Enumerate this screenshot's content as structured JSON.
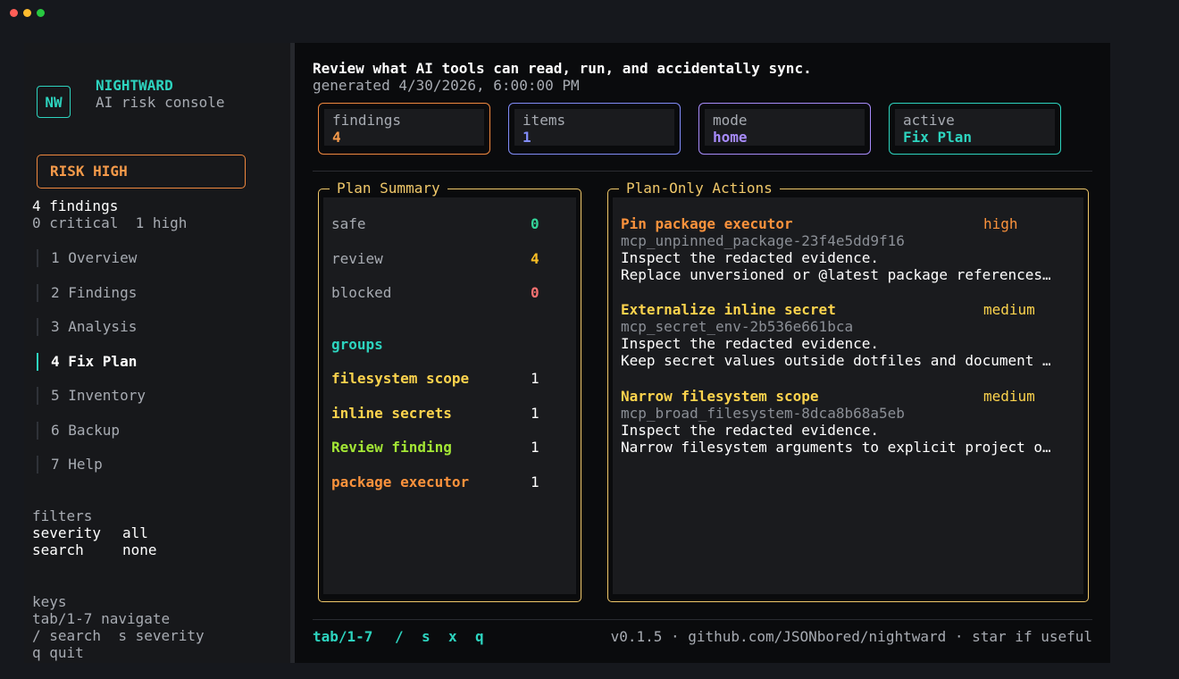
{
  "window": {
    "dots": [
      "#ff5f57",
      "#febc2e",
      "#28c840"
    ]
  },
  "sidebar": {
    "logo": "NW",
    "app_name": "NIGHTWARD",
    "app_subtitle": "AI risk console",
    "risk_label": "RISK HIGH",
    "findings_count": "4 findings",
    "severity_counts": "0 critical  1 high",
    "nav": [
      {
        "label": "1 Overview"
      },
      {
        "label": "2 Findings"
      },
      {
        "label": "3 Analysis"
      },
      {
        "label": "4 Fix Plan",
        "active": true
      },
      {
        "label": "5 Inventory"
      },
      {
        "label": "6 Backup"
      },
      {
        "label": "7 Help"
      }
    ],
    "filters_heading": "filters",
    "filters": [
      {
        "key": "severity",
        "value": "all"
      },
      {
        "key": "search",
        "value": "none"
      }
    ],
    "keys_heading": "keys",
    "keys": [
      "tab/1-7 navigate",
      "/ search  s severity",
      "q quit"
    ]
  },
  "header": {
    "title": "Review what AI tools can read, run, and accidentally sync.",
    "generated": "generated 4/30/2026, 6:00:00 PM"
  },
  "stats": [
    {
      "label": "findings",
      "value": "4",
      "color": "#f0883e"
    },
    {
      "label": "items",
      "value": "1",
      "color": "#818cf8"
    },
    {
      "label": "mode",
      "value": "home",
      "color": "#a78bfa"
    },
    {
      "label": "active",
      "value": "Fix Plan",
      "color": "#2dd4bf"
    }
  ],
  "plan_summary": {
    "title": "Plan Summary",
    "counts": [
      {
        "label": "safe",
        "value": "0",
        "color": "#34d399"
      },
      {
        "label": "review",
        "value": "4",
        "color": "#fbbf24"
      },
      {
        "label": "blocked",
        "value": "0",
        "color": "#f87171"
      }
    ],
    "groups_heading": "groups",
    "groups": [
      {
        "label": "filesystem scope",
        "value": "1",
        "color": "#fcd34d"
      },
      {
        "label": "inline secrets",
        "value": "1",
        "color": "#fcd34d"
      },
      {
        "label": "Review finding",
        "value": "1",
        "color": "#a3e635"
      },
      {
        "label": "package executor",
        "value": "1",
        "color": "#fb923c"
      }
    ]
  },
  "plan_actions": {
    "title": "Plan-Only Actions",
    "items": [
      {
        "title": "Pin package executor",
        "severity": "high",
        "title_color": "#fb923c",
        "severity_color": "#fb923c",
        "id": "mcp_unpinned_package-23f4e5dd9f16",
        "line1": "Inspect the redacted evidence.",
        "line2": "Replace unversioned or @latest package references…"
      },
      {
        "title": "Externalize inline secret",
        "severity": "medium",
        "title_color": "#fcd34d",
        "severity_color": "#fcd34d",
        "id": "mcp_secret_env-2b536e661bca",
        "line1": "Inspect the redacted evidence.",
        "line2": "Keep secret values outside dotfiles and document …"
      },
      {
        "title": "Narrow filesystem scope",
        "severity": "medium",
        "title_color": "#fcd34d",
        "severity_color": "#fcd34d",
        "id": "mcp_broad_filesystem-8dca8b68a5eb",
        "line1": "Inspect the redacted evidence.",
        "line2": "Narrow filesystem arguments to explicit project o…"
      }
    ]
  },
  "footer": {
    "keys": [
      "tab/1-7",
      "/",
      "s",
      "x",
      "q"
    ],
    "version_info": "v0.1.5 · github.com/JSONbored/nightward · star if useful"
  }
}
